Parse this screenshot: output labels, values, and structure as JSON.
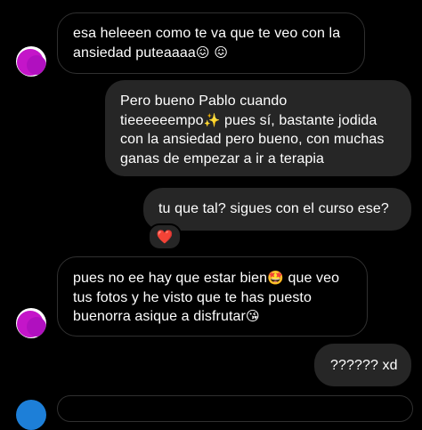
{
  "conversation": {
    "messages": [
      {
        "direction": "incoming",
        "lines": [
          "esa heleeen como te va que te veo con la",
          "ansiedad puteaaaa"
        ],
        "emoji_after_line_2": "😖 😖"
      },
      {
        "direction": "outgoing",
        "lines": [
          "Pero bueno Pablo cuando",
          "tieeeeeempo",
          "con la ansiedad pero bueno, con muchas",
          "ganas de empezar a ir a terapia"
        ],
        "line_2_emoji": "✨",
        "line_2_suffix": " pues sí, bastante jodida"
      },
      {
        "direction": "outgoing",
        "lines": [
          "tu que tal? sigues con el curso ese?"
        ],
        "reaction": "❤️"
      },
      {
        "direction": "incoming",
        "lines": [
          "pues no ee hay que estar bien",
          "tus fotos y he visto que te has puesto",
          "buenorra asique a disfrutar"
        ],
        "line_1_emoji": "🤩",
        "line_1_suffix": " que veo",
        "line_3_emoji": "😘"
      },
      {
        "direction": "outgoing",
        "lines": [
          "?????? xd"
        ]
      }
    ]
  },
  "colors": {
    "background": "#000000",
    "outgoing_bubble": "#262626",
    "incoming_border": "#303030",
    "avatar_accent": "#c415c9",
    "bottom_avatar": "#1d7fd8"
  }
}
